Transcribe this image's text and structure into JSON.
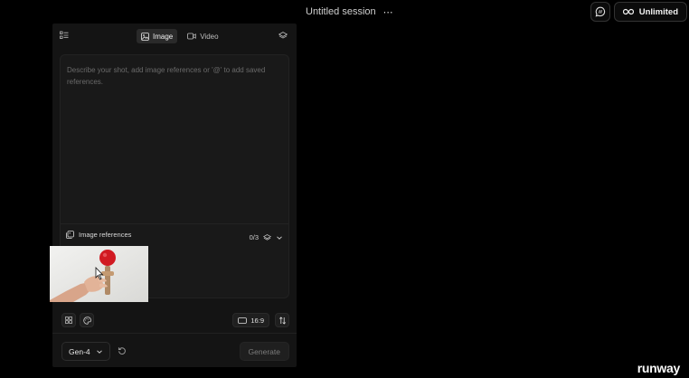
{
  "header": {
    "session_title": "Untitled session",
    "session_menu": "⋯",
    "plan_label": "Unlimited"
  },
  "panel": {
    "tabs": [
      {
        "label": "Image",
        "icon": "image-icon",
        "active": true
      },
      {
        "label": "Video",
        "icon": "video-icon",
        "active": false
      }
    ],
    "prompt": {
      "value": "",
      "placeholder": "Describe your shot, add image references or '@' to add saved references."
    },
    "image_references_label": "Image references",
    "reference_count": "0/3",
    "aspect_ratio": "16:9",
    "model": "Gen-4",
    "generate_label": "Generate"
  },
  "brand": {
    "logo": "runway"
  },
  "colors": {
    "background": "#000000",
    "panel": "#141414",
    "kendama_ball": "#d11a22"
  }
}
